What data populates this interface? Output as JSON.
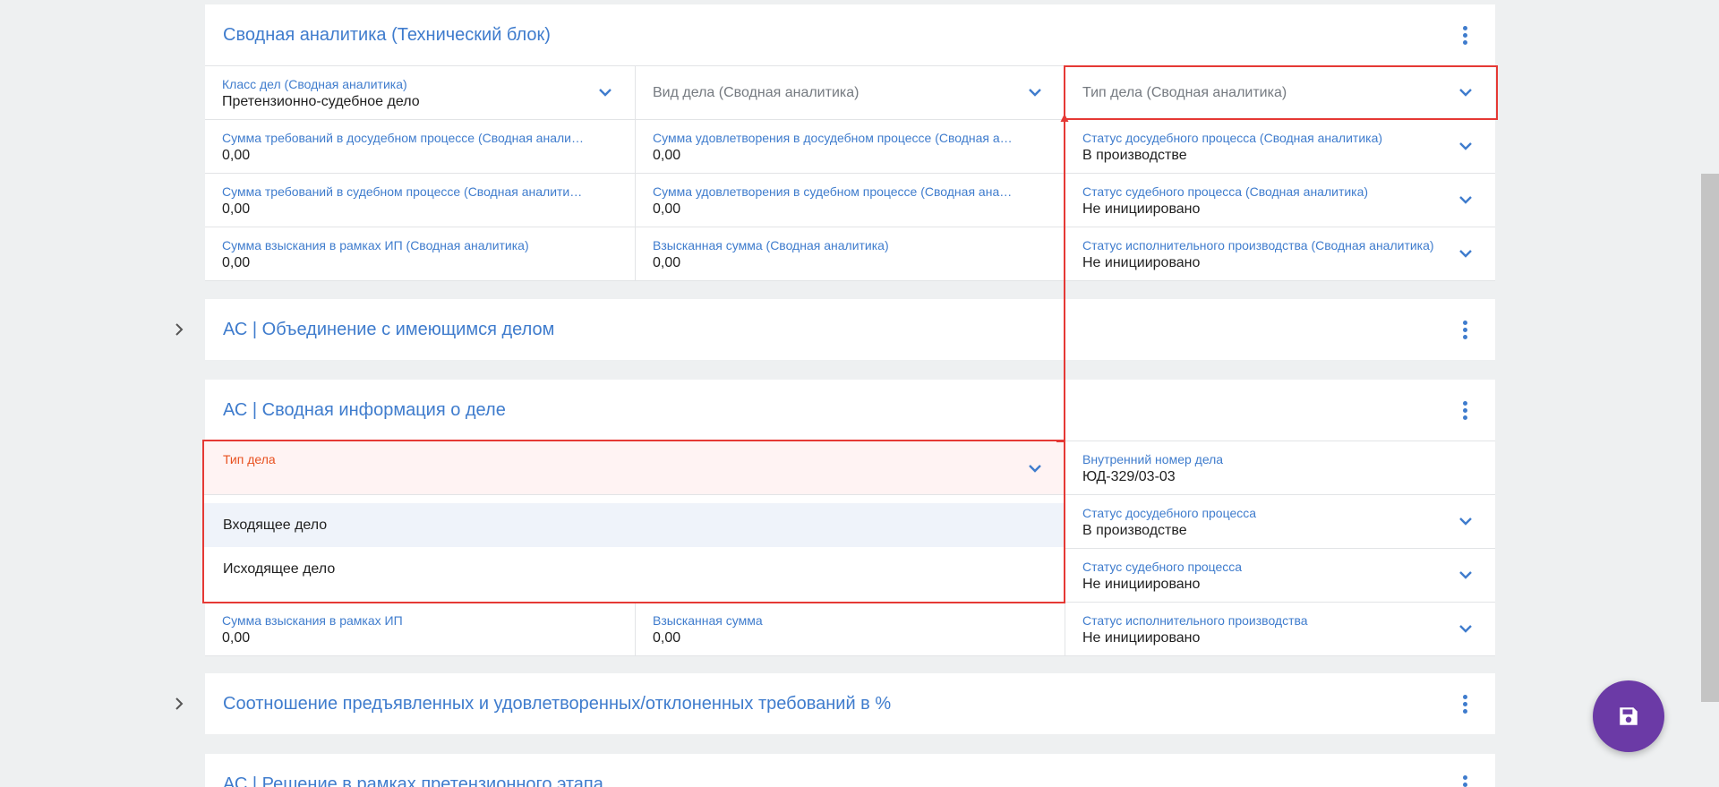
{
  "panel_summary_tech": {
    "title": "Сводная аналитика (Технический блок)",
    "rows": [
      [
        {
          "label": "Класс дел (Сводная аналитика)",
          "value": "Претензионно-судебное дело",
          "dropdown": true
        },
        {
          "placeholder": "Вид дела (Сводная аналитика)",
          "dropdown": true
        },
        {
          "placeholder": "Тип дела (Сводная аналитика)",
          "dropdown": true
        }
      ],
      [
        {
          "label": "Сумма требований в досудебном процессе (Сводная аналитика)",
          "value": "0,00"
        },
        {
          "label": "Сумма удовлетворения в досудебном процессе (Сводная аналитика)",
          "value": "0,00"
        },
        {
          "label": "Статус досудебного процесса (Сводная аналитика)",
          "value": "В производстве",
          "dropdown": true
        }
      ],
      [
        {
          "label": "Сумма требований в судебном процессе (Сводная аналитика)",
          "value": "0,00"
        },
        {
          "label": "Сумма удовлетворения в судебном процессе (Сводная аналитика)",
          "value": "0,00"
        },
        {
          "label": "Статус судебного процесса (Сводная аналитика)",
          "value": "Не инициировано",
          "dropdown": true
        }
      ],
      [
        {
          "label": "Сумма взыскания в рамках ИП (Сводная аналитика)",
          "value": "0,00"
        },
        {
          "label": "Взысканная сумма (Сводная аналитика)",
          "value": "0,00"
        },
        {
          "label": "Статус исполнительного производства (Сводная аналитика)",
          "value": "Не инициировано",
          "dropdown": true
        }
      ]
    ]
  },
  "panel_merge": {
    "title": "АС | Объединение с имеющимся делом"
  },
  "panel_case_info": {
    "title": "АС | Сводная информация о деле",
    "right_column": [
      {
        "label": "Внутренний номер дела",
        "value": "ЮД-329/03-03"
      },
      {
        "label": "Статус досудебного процесса",
        "value": "В производстве",
        "dropdown": true
      },
      {
        "label": "Статус судебного процесса",
        "value": "Не инициировано",
        "dropdown": true
      }
    ],
    "last_row": [
      {
        "label": "Сумма взыскания в рамках ИП",
        "value": "0,00"
      },
      {
        "label": "Взысканная сумма",
        "value": "0,00"
      },
      {
        "label": "Статус исполнительного производства",
        "value": "Не инициировано",
        "dropdown": true
      }
    ],
    "case_type_field": {
      "label": "Тип дела",
      "options": [
        "Входящее дело",
        "Исходящее дело"
      ]
    }
  },
  "panel_ratio": {
    "title": "Соотношение предъявленных и удовлетворенных/отклоненных требований в %"
  },
  "panel_pretrial": {
    "title": "АС | Решение в рамках претензионного этапа"
  },
  "colors": {
    "accent": "#3f7ccd",
    "highlight": "#e53935",
    "error_label": "#e8501f",
    "fab": "#6b3aa6",
    "background": "#eef0f1"
  },
  "icons": {
    "chevron": "chevron-down-icon",
    "kebab": "more-vertical-icon",
    "expand": "chevron-right-icon",
    "save": "save-icon"
  }
}
